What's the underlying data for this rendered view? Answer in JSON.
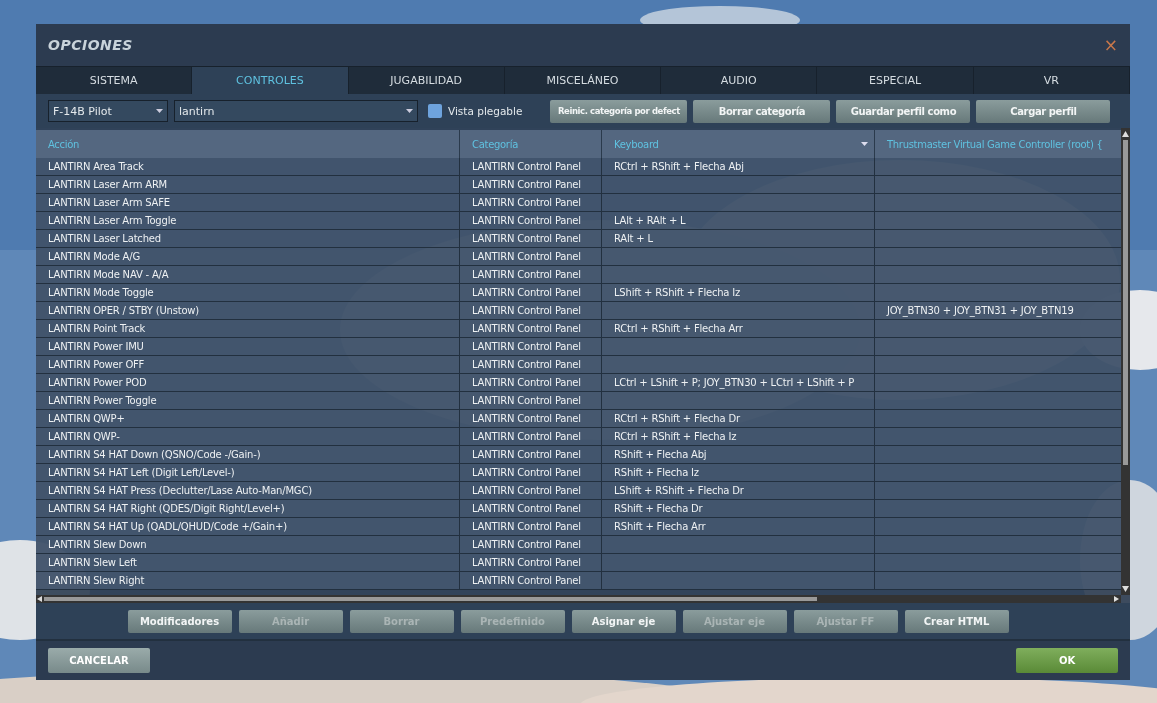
{
  "window": {
    "title": "OPCIONES",
    "close": "×"
  },
  "tabs": [
    {
      "label": "SISTEMA",
      "selected": false
    },
    {
      "label": "CONTROLES",
      "selected": true
    },
    {
      "label": "JUGABILIDAD",
      "selected": false
    },
    {
      "label": "MISCELÁNEO",
      "selected": false
    },
    {
      "label": "AUDIO",
      "selected": false
    },
    {
      "label": "ESPECIAL",
      "selected": false
    },
    {
      "label": "VR",
      "selected": false
    }
  ],
  "toolbar": {
    "aircraft": "F-14B Pilot",
    "category": "lantirn",
    "collapsible_view": {
      "label": "Vista plegable",
      "checked": false
    },
    "buttons": [
      {
        "label": "Reinic. categoría por defect",
        "disabled": false
      },
      {
        "label": "Borrar categoría",
        "disabled": false
      },
      {
        "label": "Guardar perfil como",
        "disabled": false
      },
      {
        "label": "Cargar perfil",
        "disabled": false
      }
    ]
  },
  "table": {
    "columns": [
      {
        "label": "Acción",
        "sortable": false
      },
      {
        "label": "Categoría",
        "sortable": false
      },
      {
        "label": "Keyboard",
        "sortable": true
      },
      {
        "label": "Thrustmaster Virtual Game Controller (root) {",
        "sortable": false
      }
    ],
    "rows": [
      [
        "LANTIRN Area Track",
        "LANTIRN Control Panel",
        "RCtrl + RShift + Flecha Abj",
        ""
      ],
      [
        "LANTIRN Laser Arm ARM",
        "LANTIRN Control Panel",
        "",
        ""
      ],
      [
        "LANTIRN Laser Arm SAFE",
        "LANTIRN Control Panel",
        "",
        ""
      ],
      [
        "LANTIRN Laser Arm Toggle",
        "LANTIRN Control Panel",
        "LAlt + RAlt + L",
        ""
      ],
      [
        "LANTIRN Laser Latched",
        "LANTIRN Control Panel",
        "RAlt + L",
        ""
      ],
      [
        "LANTIRN Mode A/G",
        "LANTIRN Control Panel",
        "",
        ""
      ],
      [
        "LANTIRN Mode NAV - A/A",
        "LANTIRN Control Panel",
        "",
        ""
      ],
      [
        "LANTIRN Mode Toggle",
        "LANTIRN Control Panel",
        "LShift + RShift + Flecha Iz",
        ""
      ],
      [
        "LANTIRN OPER / STBY (Unstow)",
        "LANTIRN Control Panel",
        "",
        "JOY_BTN30 + JOY_BTN31 + JOY_BTN19"
      ],
      [
        "LANTIRN Point Track",
        "LANTIRN Control Panel",
        "RCtrl + RShift + Flecha Arr",
        ""
      ],
      [
        "LANTIRN Power IMU",
        "LANTIRN Control Panel",
        "",
        ""
      ],
      [
        "LANTIRN Power OFF",
        "LANTIRN Control Panel",
        "",
        ""
      ],
      [
        "LANTIRN Power POD",
        "LANTIRN Control Panel",
        "LCtrl + LShift + P; JOY_BTN30 + LCtrl + LShift + P",
        ""
      ],
      [
        "LANTIRN Power Toggle",
        "LANTIRN Control Panel",
        "",
        ""
      ],
      [
        "LANTIRN QWP+",
        "LANTIRN Control Panel",
        "RCtrl + RShift + Flecha Dr",
        ""
      ],
      [
        "LANTIRN QWP-",
        "LANTIRN Control Panel",
        "RCtrl + RShift + Flecha Iz",
        ""
      ],
      [
        "LANTIRN S4 HAT Down (QSNO/Code -/Gain-)",
        "LANTIRN Control Panel",
        "RShift + Flecha Abj",
        ""
      ],
      [
        "LANTIRN S4 HAT Left (Digit Left/Level-)",
        "LANTIRN Control Panel",
        "RShift + Flecha Iz",
        ""
      ],
      [
        "LANTIRN S4 HAT Press (Declutter/Lase Auto-Man/MGC)",
        "LANTIRN Control Panel",
        "LShift + RShift + Flecha Dr",
        ""
      ],
      [
        "LANTIRN S4 HAT Right (QDES/Digit Right/Level+)",
        "LANTIRN Control Panel",
        "RShift + Flecha Dr",
        ""
      ],
      [
        "LANTIRN S4 HAT Up (QADL/QHUD/Code +/Gain+)",
        "LANTIRN Control Panel",
        "RShift + Flecha Arr",
        ""
      ],
      [
        "LANTIRN Slew Down",
        "LANTIRN Control Panel",
        "",
        ""
      ],
      [
        "LANTIRN Slew Left",
        "LANTIRN Control Panel",
        "",
        ""
      ],
      [
        "LANTIRN Slew Right",
        "LANTIRN Control Panel",
        "",
        ""
      ]
    ]
  },
  "actions": [
    {
      "label": "Modificadores",
      "disabled": false
    },
    {
      "label": "Añadir",
      "disabled": true
    },
    {
      "label": "Borrar",
      "disabled": true
    },
    {
      "label": "Predefinido",
      "disabled": true
    },
    {
      "label": "Asignar eje",
      "disabled": false
    },
    {
      "label": "Ajustar eje",
      "disabled": true
    },
    {
      "label": "Ajustar FF",
      "disabled": true
    },
    {
      "label": "Crear HTML",
      "disabled": false
    }
  ],
  "footer": [
    {
      "label": "CANCELAR",
      "kind": "cancel"
    },
    {
      "label": "OK",
      "kind": "confirm"
    }
  ]
}
